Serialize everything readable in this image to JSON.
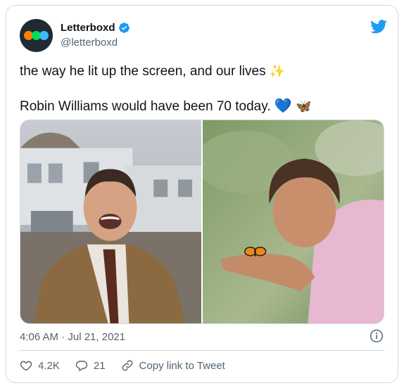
{
  "tweet": {
    "account": {
      "display_name": "Letterboxd",
      "handle": "@letterboxd",
      "verified": true,
      "avatar_icon": "letterboxd-logo",
      "avatar_colors": [
        "#ff8000",
        "#00e054",
        "#40bcf4"
      ]
    },
    "text": {
      "line1": "the way he lit up the screen, and our lives",
      "line1_emoji": "✨",
      "line2": "Robin Williams would have been 70 today.",
      "line2_emoji_1": "💙",
      "line2_emoji_2": "🦋"
    },
    "media": [
      {
        "name": "photo-laughing-in-coat"
      },
      {
        "name": "photo-butterfly-in-hand"
      }
    ],
    "timestamp": "4:06 AM · Jul 21, 2021",
    "actions": {
      "likes": "4.2K",
      "replies": "21",
      "copy_link_label": "Copy link to Tweet"
    },
    "brand_color": "#1d9bf0"
  }
}
